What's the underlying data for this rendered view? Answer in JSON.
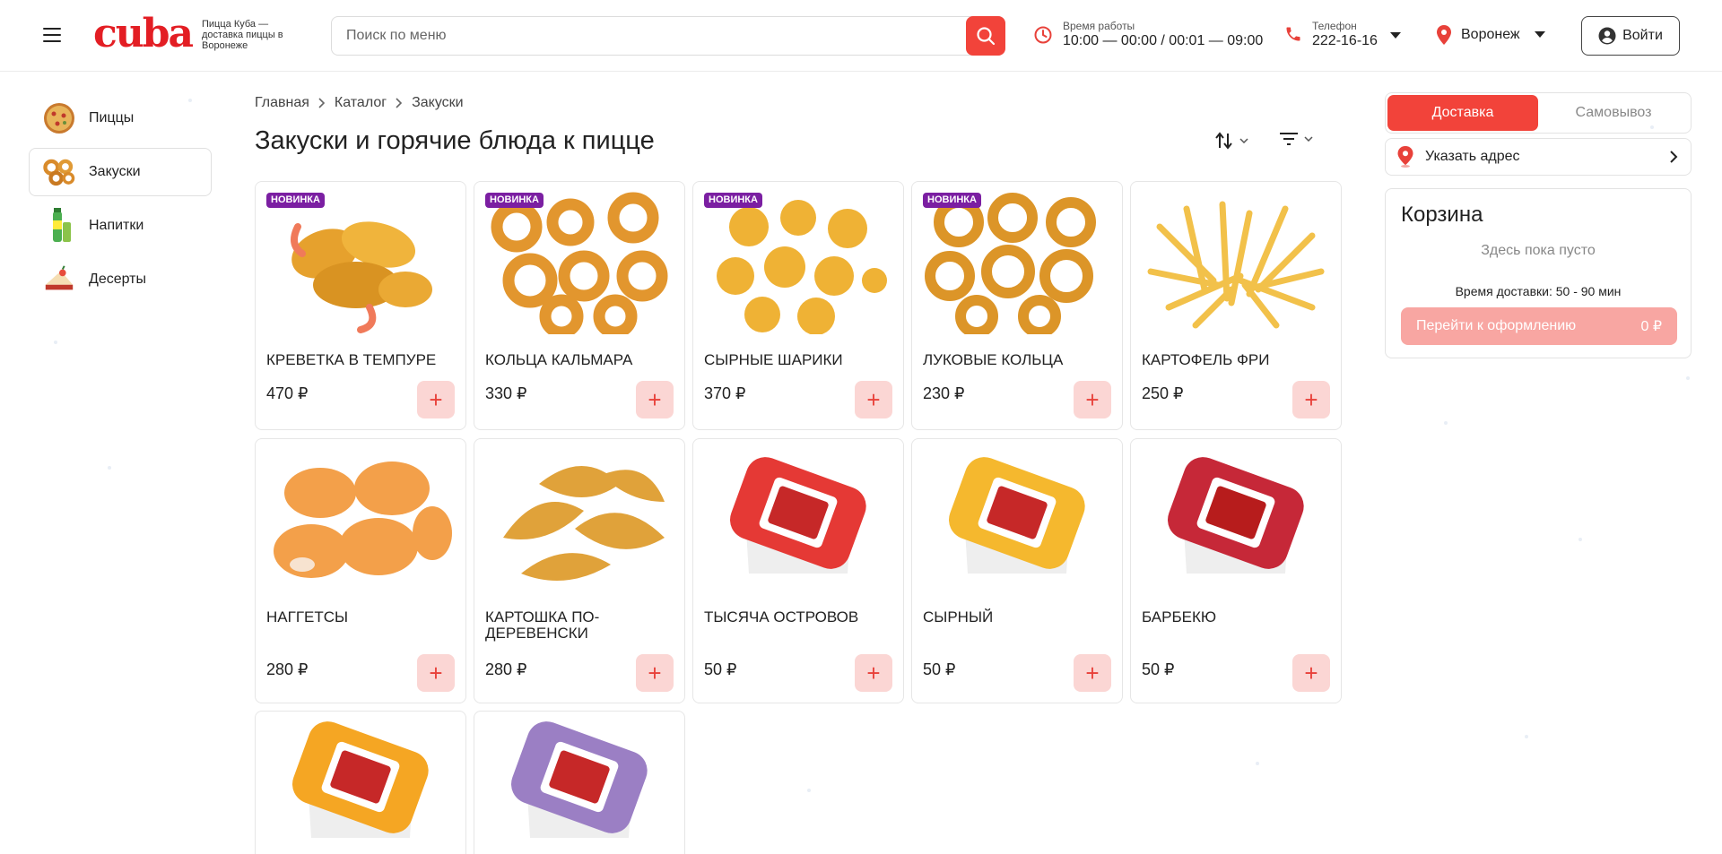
{
  "header": {
    "logo": "cuba",
    "tagline": "Пицца Куба — доставка пиццы в Воронеже",
    "search_placeholder": "Поиск по меню",
    "hours_label": "Время работы",
    "hours_value": "10:00 — 00:00 / 00:01 — 09:00",
    "phone_label": "Телефон",
    "phone_value": "222-16-16",
    "city": "Воронеж",
    "login_label": "Войти"
  },
  "sidebar": {
    "items": [
      {
        "label": "Пиццы",
        "icon": "pizza-icon"
      },
      {
        "label": "Закуски",
        "icon": "onion-rings-icon",
        "active": true
      },
      {
        "label": "Напитки",
        "icon": "drink-icon"
      },
      {
        "label": "Десерты",
        "icon": "dessert-icon"
      }
    ]
  },
  "breadcrumb": [
    "Главная",
    "Каталог",
    "Закуски"
  ],
  "page_title": "Закуски и горячие блюда к пицце",
  "badge_label": "НОВИНКА",
  "products": [
    {
      "name": "КРЕВЕТКА В ТЕМПУРЕ",
      "price": "470 ₽",
      "new": true,
      "image": "tempura-shrimp"
    },
    {
      "name": "КОЛЬЦА КАЛЬМАРА",
      "price": "330 ₽",
      "new": true,
      "image": "squid-rings"
    },
    {
      "name": "СЫРНЫЕ ШАРИКИ",
      "price": "370 ₽",
      "new": true,
      "image": "cheese-balls"
    },
    {
      "name": "ЛУКОВЫЕ КОЛЬЦА",
      "price": "230 ₽",
      "new": true,
      "image": "onion-rings"
    },
    {
      "name": "КАРТОФЕЛЬ ФРИ",
      "price": "250 ₽",
      "new": false,
      "image": "french-fries"
    },
    {
      "name": "НАГГЕТСЫ",
      "price": "280 ₽",
      "new": false,
      "image": "nuggets"
    },
    {
      "name": "КАРТОШКА ПО-ДЕРЕВЕНСКИ",
      "price": "280 ₽",
      "new": false,
      "image": "potato-wedges"
    },
    {
      "name": "ТЫСЯЧА ОСТРОВОВ",
      "price": "50 ₽",
      "new": false,
      "image": "sauce-thousand-island"
    },
    {
      "name": "СЫРНЫЙ",
      "price": "50 ₽",
      "new": false,
      "image": "sauce-cheese"
    },
    {
      "name": "БАРБЕКЮ",
      "price": "50 ₽",
      "new": false,
      "image": "sauce-bbq"
    },
    {
      "name": "",
      "price": "",
      "new": false,
      "image": "sauce-sweet-sour"
    },
    {
      "name": "",
      "price": "",
      "new": false,
      "image": "sauce-garlic"
    }
  ],
  "order_panel": {
    "tab_delivery": "Доставка",
    "tab_pickup": "Самовывоз",
    "address_label": "Указать адрес",
    "cart_title": "Корзина",
    "cart_empty": "Здесь пока пусто",
    "delivery_time": "Время доставки: 50 - 90 мин",
    "checkout_label": "Перейти к оформлению",
    "checkout_total": "0 ₽"
  },
  "colors": {
    "brand_red": "#e31e24",
    "accent": "#f2433a",
    "add_button_bg": "#fbd6d4",
    "badge": "#7b1fa2"
  }
}
